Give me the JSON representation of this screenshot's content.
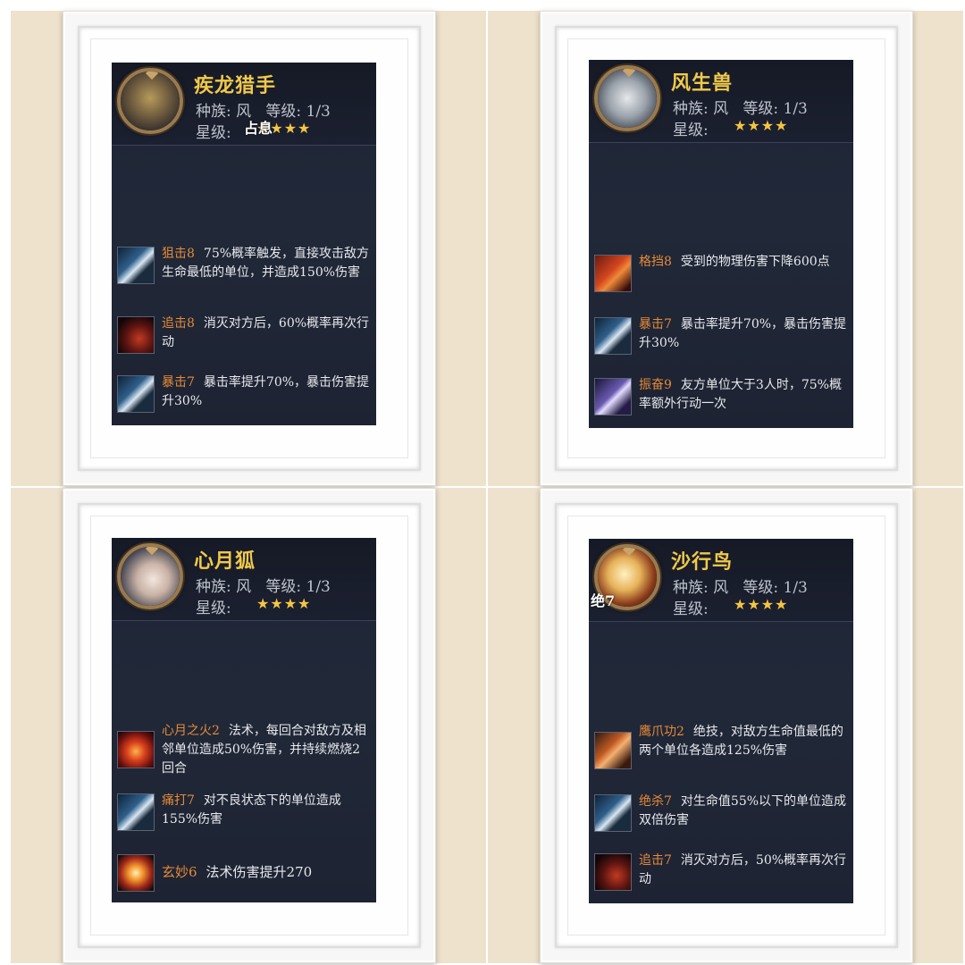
{
  "labels": {
    "race": "种族:",
    "level": "等级:",
    "star": "星级:"
  },
  "cards": [
    {
      "name": "疾龙猎手",
      "race": "风",
      "level": "1/3",
      "stars": "★★★★",
      "overlay": "占息",
      "skills": [
        {
          "name": "狙击8",
          "desc": "75%概率触发，直接攻击敌方生命最低的单位，并造成150%伤害",
          "icon": "sword-icon"
        },
        {
          "name": "追击8",
          "desc": "消灭对方后，60%概率再次行动",
          "icon": "chase-icon"
        },
        {
          "name": "暴击7",
          "desc": "暴击率提升70%，暴击伤害提升30%",
          "icon": "sword-icon"
        }
      ]
    },
    {
      "name": "风生兽",
      "race": "风",
      "level": "1/3",
      "stars": "★★★★",
      "overlay": "",
      "skills": [
        {
          "name": "格挡8",
          "desc": "受到的物理伤害下降600点",
          "icon": "shield-icon"
        },
        {
          "name": "暴击7",
          "desc": "暴击率提升70%，暴击伤害提升30%",
          "icon": "sword-icon"
        },
        {
          "name": "振奋9",
          "desc": "友方单位大于3人时，75%概率额外行动一次",
          "icon": "spark-icon"
        }
      ]
    },
    {
      "name": "心月狐",
      "race": "风",
      "level": "1/3",
      "stars": "★★★★",
      "overlay": "",
      "skills": [
        {
          "name": "心月之火2",
          "desc": "法术，每回合对敌方及相邻单位造成50%伤害，并持续燃烧2回合",
          "icon": "fire-icon"
        },
        {
          "name": "痛打7",
          "desc": "对不良状态下的单位造成155%伤害",
          "icon": "sword-icon"
        },
        {
          "name": "玄妙6",
          "desc": "法术伤害提升270",
          "icon": "burst-icon"
        }
      ]
    },
    {
      "name": "沙行鸟",
      "race": "风",
      "level": "1/3",
      "stars": "★★★★",
      "overlay": "绝7",
      "skills": [
        {
          "name": "鹰爪功2",
          "desc": "绝技，对敌方生命值最低的两个单位各造成125%伤害",
          "icon": "claw-icon"
        },
        {
          "name": "绝杀7",
          "desc": "对生命值55%以下的单位造成双倍伤害",
          "icon": "sword-icon"
        },
        {
          "name": "追击7",
          "desc": "消灭对方后，50%概率再次行动",
          "icon": "chase-icon"
        }
      ]
    }
  ]
}
